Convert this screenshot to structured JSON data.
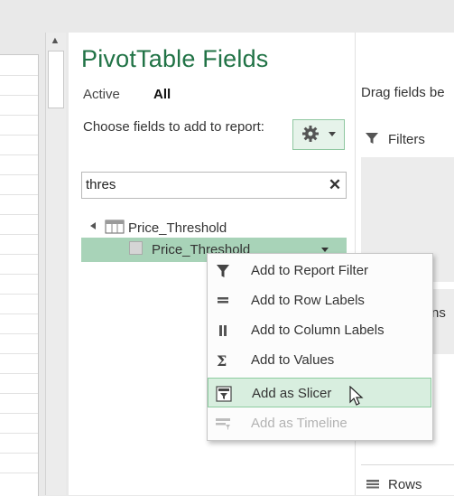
{
  "panel": {
    "title": "PivotTable Fields",
    "tabs": [
      {
        "label": "Active",
        "selected": false
      },
      {
        "label": "All",
        "selected": true
      }
    ],
    "choose_label": "Choose fields to add to report:",
    "settings_icon": "gear-icon"
  },
  "search": {
    "value": "thres",
    "clear_icon": "close-icon",
    "clear_label": "✕"
  },
  "tree": {
    "table": {
      "label": "Price_Threshold",
      "expanded": true
    },
    "field": {
      "label": "Price_Threshold",
      "checked": false
    }
  },
  "areas": {
    "drag_label": "Drag fields be",
    "filters_label": "Filters",
    "columns_fragment": "ns",
    "rows_label": "Rows"
  },
  "context_menu": {
    "items": [
      {
        "label": "Add to Report Filter",
        "icon": "filter-icon",
        "enabled": true
      },
      {
        "label": "Add to Row Labels",
        "icon": "rows-icon",
        "enabled": true
      },
      {
        "label": "Add to Column Labels",
        "icon": "columns-icon",
        "enabled": true
      },
      {
        "label": "Add to Values",
        "icon": "sigma-icon",
        "enabled": true
      },
      {
        "label": "Add as Slicer",
        "icon": "slicer-icon",
        "enabled": true,
        "hovered": true
      },
      {
        "label": "Add as Timeline",
        "icon": "timeline-icon",
        "enabled": false
      }
    ]
  },
  "scrollbar": {
    "up_glyph": "▲"
  },
  "colors": {
    "accent": "#217346",
    "selection": "#a8d3b8",
    "hover": "#d8eedf"
  }
}
